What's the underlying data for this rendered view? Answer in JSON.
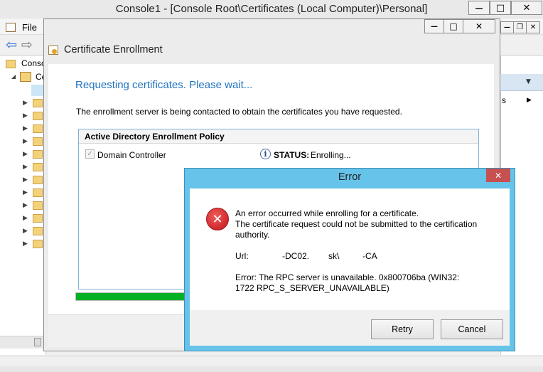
{
  "mmc": {
    "title": "Console1 - [Console Root\\Certificates (Local Computer)\\Personal]",
    "menu_file": "File",
    "tree_root": "Conso",
    "tree_child": "Ce",
    "right_pane_text": "s"
  },
  "enrollment": {
    "title": "Certificate Enrollment",
    "heading": "Requesting certificates. Please wait...",
    "description": "The enrollment server is being contacted to obtain the certificates you have requested.",
    "policy_header": "Active Directory Enrollment Policy",
    "item_label": "Domain Controller",
    "status_label": "STATUS:",
    "status_value": "Enrolling...",
    "item_checked": true,
    "progress_fraction": 0.27
  },
  "error_dialog": {
    "title": "Error",
    "line1": "An error occurred while enrolling for a certificate.",
    "line2": "The certificate request could not be submitted to the certification authority.",
    "url_label": "Url:",
    "url_part1": "-DC02.",
    "url_part2": "sk\\",
    "url_part3": "-CA",
    "error_text": "Error: The RPC server is unavailable. 0x800706ba (WIN32: 1722 RPC_S_SERVER_UNAVAILABLE)",
    "retry_label": "Retry",
    "cancel_label": "Cancel"
  },
  "icons": {
    "close_glyph": "✕",
    "maximize_glyph": "□",
    "minimize_glyph": "—",
    "restore_glyph": "❐",
    "error_glyph": "✕",
    "info_glyph": "i",
    "check_glyph": "✓",
    "dropdown_glyph": "▼",
    "expand_glyph": "▶",
    "collapse_glyph": "◢",
    "back_glyph": "⇦",
    "forward_glyph": "⇨"
  },
  "colors": {
    "accent_blue": "#1e73be",
    "dialog_frame": "#66c3e9",
    "close_red": "#c75050",
    "progress_green": "#06b025",
    "error_red": "#d7262b"
  }
}
